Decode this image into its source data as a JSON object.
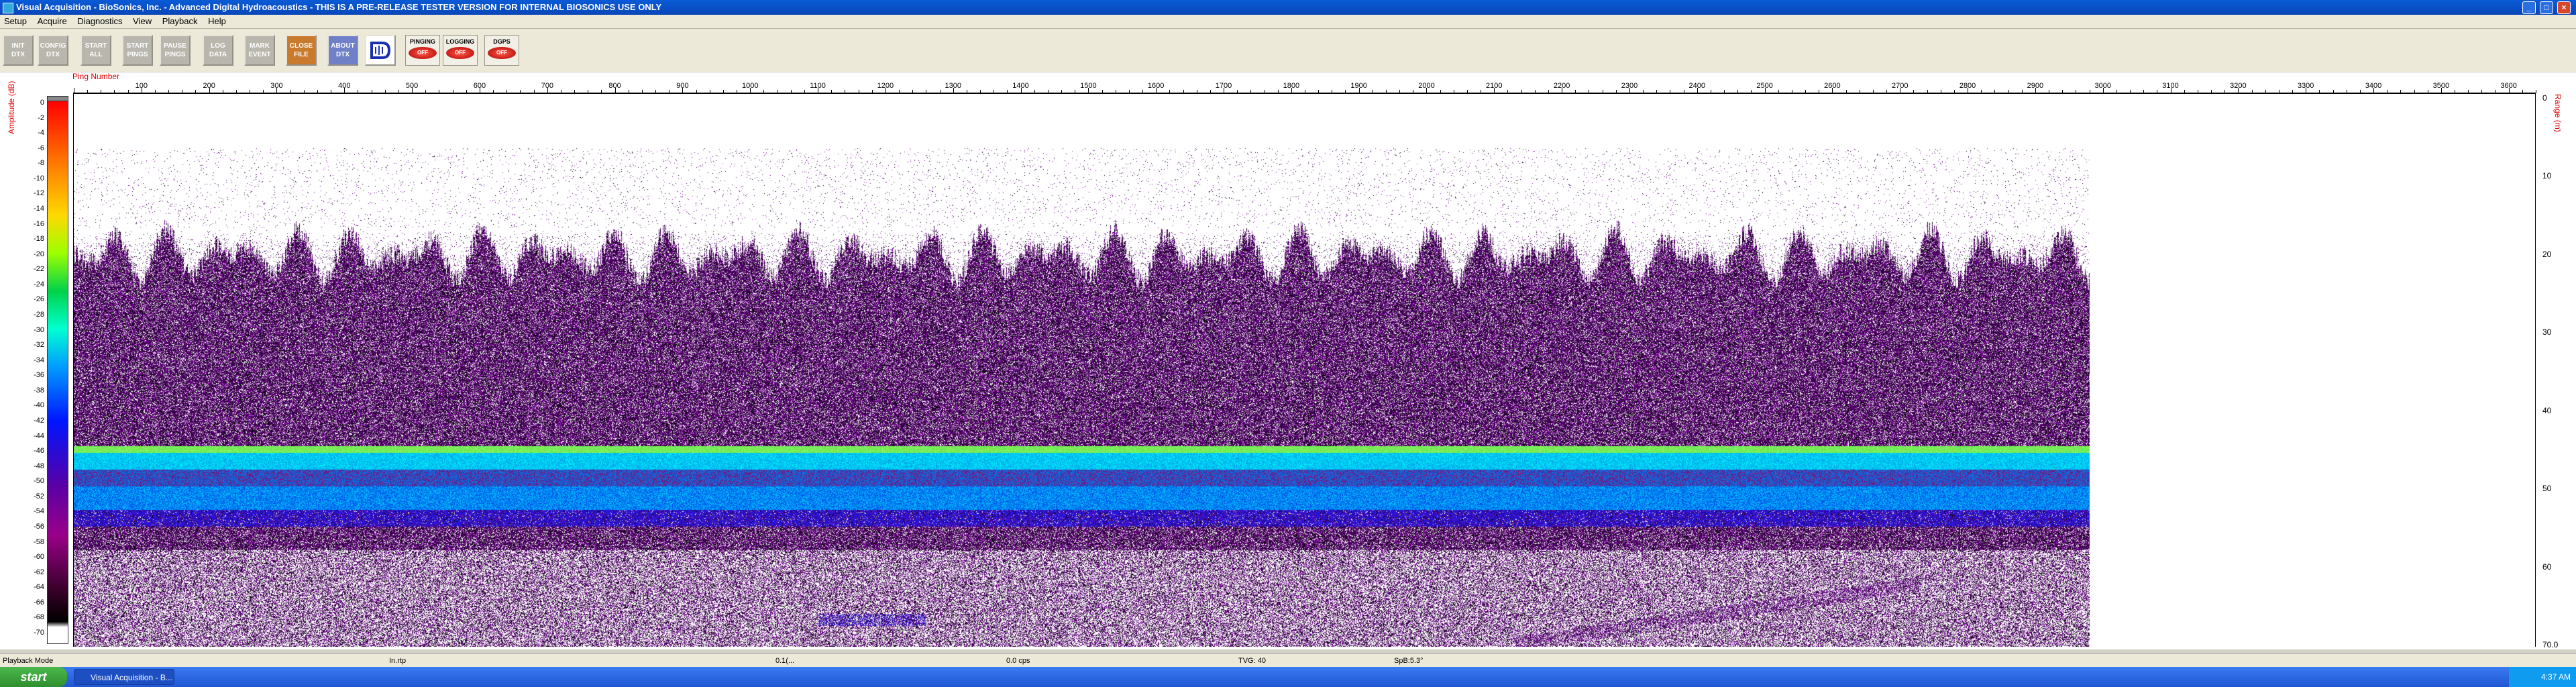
{
  "window": {
    "title": "Visual Acquisition - BioSonics, Inc. - Advanced Digital Hydroacoustics - THIS IS A PRE-RELEASE TESTER VERSION FOR INTERNAL BIOSONICS USE ONLY",
    "minimize": "_",
    "maximize": "□",
    "close": "×"
  },
  "menu": [
    "Setup",
    "Acquire",
    "Diagnostics",
    "View",
    "Playback",
    "Help"
  ],
  "toolbar": {
    "buttons": [
      {
        "label": "INIT DTX",
        "style": "gray"
      },
      {
        "label": "CONFIG DTX",
        "style": "gray"
      },
      {
        "label": "START ALL",
        "style": "gray"
      },
      {
        "label": "START PINGS",
        "style": "gray"
      },
      {
        "label": "PAUSE PINGS",
        "style": "gray"
      },
      {
        "label": "LOG DATA",
        "style": "gray"
      },
      {
        "label": "MARK EVENT",
        "style": "gray"
      },
      {
        "label": "CLOSE FILE",
        "style": "orange"
      },
      {
        "label": "ABOUT DTX",
        "style": "blue"
      }
    ],
    "indicators": [
      {
        "label": "PINGING",
        "state": "OFF"
      },
      {
        "label": "LOGGING",
        "state": "OFF"
      },
      {
        "label": "DGPS",
        "state": "OFF"
      }
    ]
  },
  "echogram": {
    "x_axis_label": "Ping Number",
    "x_ticks": [
      "100",
      "200",
      "300",
      "400",
      "500",
      "600",
      "700",
      "800",
      "900",
      "1000",
      "1100",
      "1200",
      "1300",
      "1400",
      "1500",
      "1600",
      "1700",
      "1800",
      "1900",
      "2000",
      "2100",
      "2200",
      "2300",
      "2400",
      "2500",
      "2600",
      "2700",
      "2800",
      "2900",
      "3000",
      "3100",
      "3200",
      "3300",
      "3400",
      "3500",
      "3600"
    ],
    "x_min": 0,
    "x_max": 3640,
    "colorbar_label": "Amplitude (dB)",
    "colorbar_ticks": [
      "0",
      "-2",
      "-4",
      "-6",
      "-8",
      "-10",
      "-12",
      "-14",
      "-16",
      "-18",
      "-20",
      "-22",
      "-24",
      "-26",
      "-28",
      "-30",
      "-32",
      "-34",
      "-36",
      "-38",
      "-40",
      "-42",
      "-44",
      "-46",
      "-48",
      "-50",
      "-52",
      "-54",
      "-56",
      "-58",
      "-60",
      "-62",
      "-64",
      "-66",
      "-68",
      "-70"
    ],
    "depth_label": "Range (m)",
    "depth_ticks": [
      "0",
      "10",
      "20",
      "30",
      "40",
      "50",
      "60",
      "70.0"
    ],
    "depth_max": 70,
    "data_extent_pings": 2980
  },
  "status": {
    "mode": "Playback Mode",
    "field2": "In.rtp",
    "field3": "0.1(...",
    "field4": "0.0 cps",
    "field5": "TVG: 40",
    "field6": "SpB:5.3°"
  },
  "taskbar": {
    "start": "start",
    "task": "Visual Acquisition - B...",
    "clock": "4:37 AM"
  }
}
